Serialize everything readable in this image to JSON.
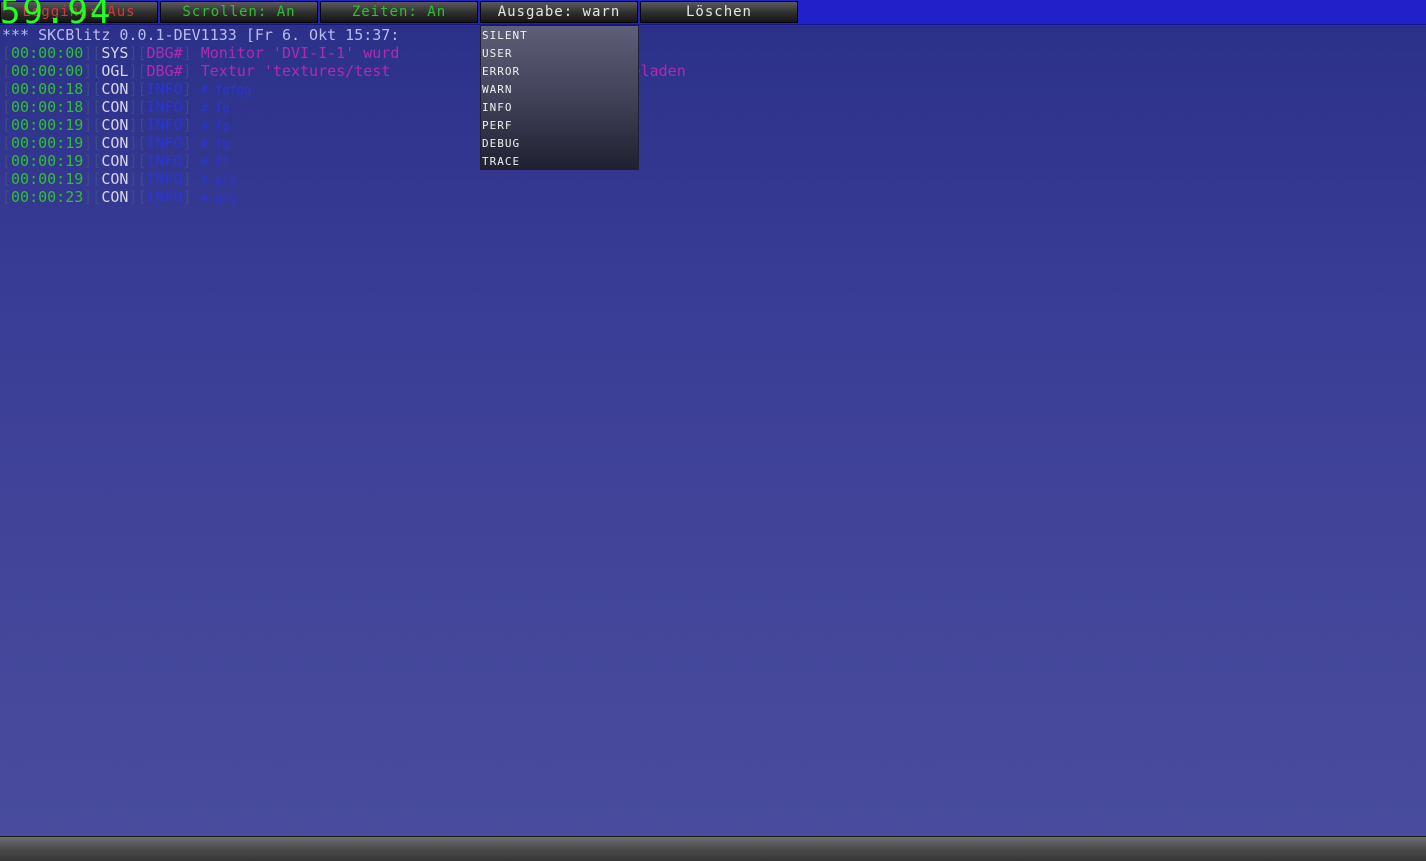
{
  "toolbar": {
    "buttons": [
      {
        "label": "Logging: Aus",
        "color": "#d23a3a"
      },
      {
        "label": "Scrollen: An",
        "color": "#2fc02f"
      },
      {
        "label": "Zeiten: An",
        "color": "#2fc02f"
      },
      {
        "label": "Ausgabe: warn",
        "color": "#e6e6e6"
      },
      {
        "label": "Löschen",
        "color": "#e6e6e6"
      }
    ]
  },
  "fps": "59.94",
  "dropdown": {
    "options": [
      "SILENT",
      "USER",
      "ERROR",
      "WARN",
      "INFO",
      "PERF",
      "DEBUG",
      "TRACE"
    ]
  },
  "log": {
    "header_left": "*** SKCBlitz 0.0.1-DEV1133 [Fr 6. Okt 15:37:",
    "header_right": "***",
    "lines": [
      {
        "time": "00:00:00",
        "src": "SYS",
        "level": "DBG#",
        "msg": "Monitor 'DVI-I-1' wurd"
      },
      {
        "time": "00:00:00",
        "src": "OGL",
        "level": "DBG#",
        "msg": "Textur 'textures/test",
        "msg_tail": "ID #7 geladen"
      },
      {
        "time": "00:00:18",
        "src": "CON",
        "level": "INFO",
        "msg": "# fgfgg"
      },
      {
        "time": "00:00:18",
        "src": "CON",
        "level": "INFO",
        "msg": "# fg"
      },
      {
        "time": "00:00:19",
        "src": "CON",
        "level": "INFO",
        "msg": "# fg"
      },
      {
        "time": "00:00:19",
        "src": "CON",
        "level": "INFO",
        "msg": "# fg"
      },
      {
        "time": "00:00:19",
        "src": "CON",
        "level": "INFO",
        "msg": "# ff"
      },
      {
        "time": "00:00:19",
        "src": "CON",
        "level": "INFO",
        "msg": "# gfg"
      },
      {
        "time": "00:00:23",
        "src": "CON",
        "level": "INFO",
        "msg": "# gfg"
      }
    ]
  }
}
